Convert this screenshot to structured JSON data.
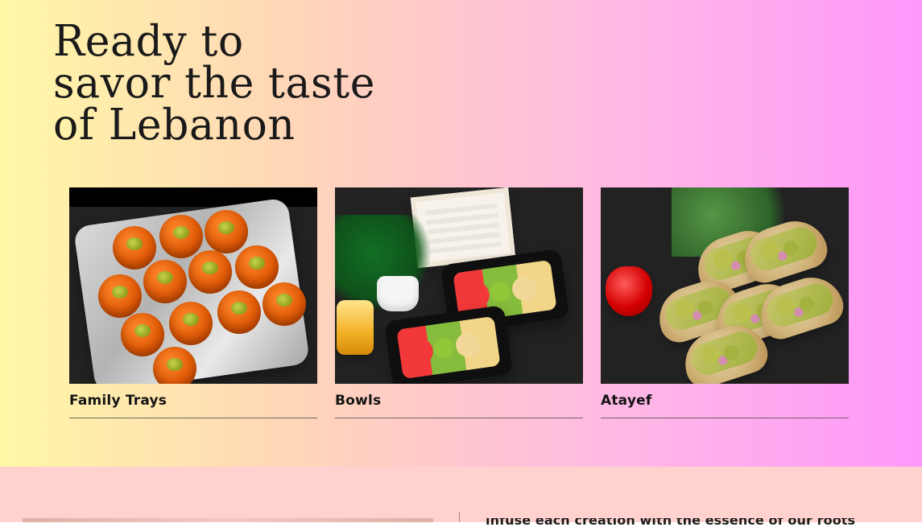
{
  "hero": {
    "headline_lines": [
      "Ready to",
      "savor the taste",
      "of Lebanon"
    ],
    "cards": [
      {
        "label": "Family Trays"
      },
      {
        "label": "Bowls"
      },
      {
        "label": "Atayef"
      }
    ]
  },
  "lower_section": {
    "partial_text": "infuse each creation with the essence of our roots"
  },
  "colors": {
    "hero_gradient_start": "#fff7a6",
    "hero_gradient_mid_1": "#ffd6b8",
    "hero_gradient_mid_2": "#ffb8e6",
    "hero_gradient_end": "#ff98fb",
    "lower_background": "#ffd2cf",
    "text_primary": "#141414",
    "divider": "#4b4b4b"
  }
}
